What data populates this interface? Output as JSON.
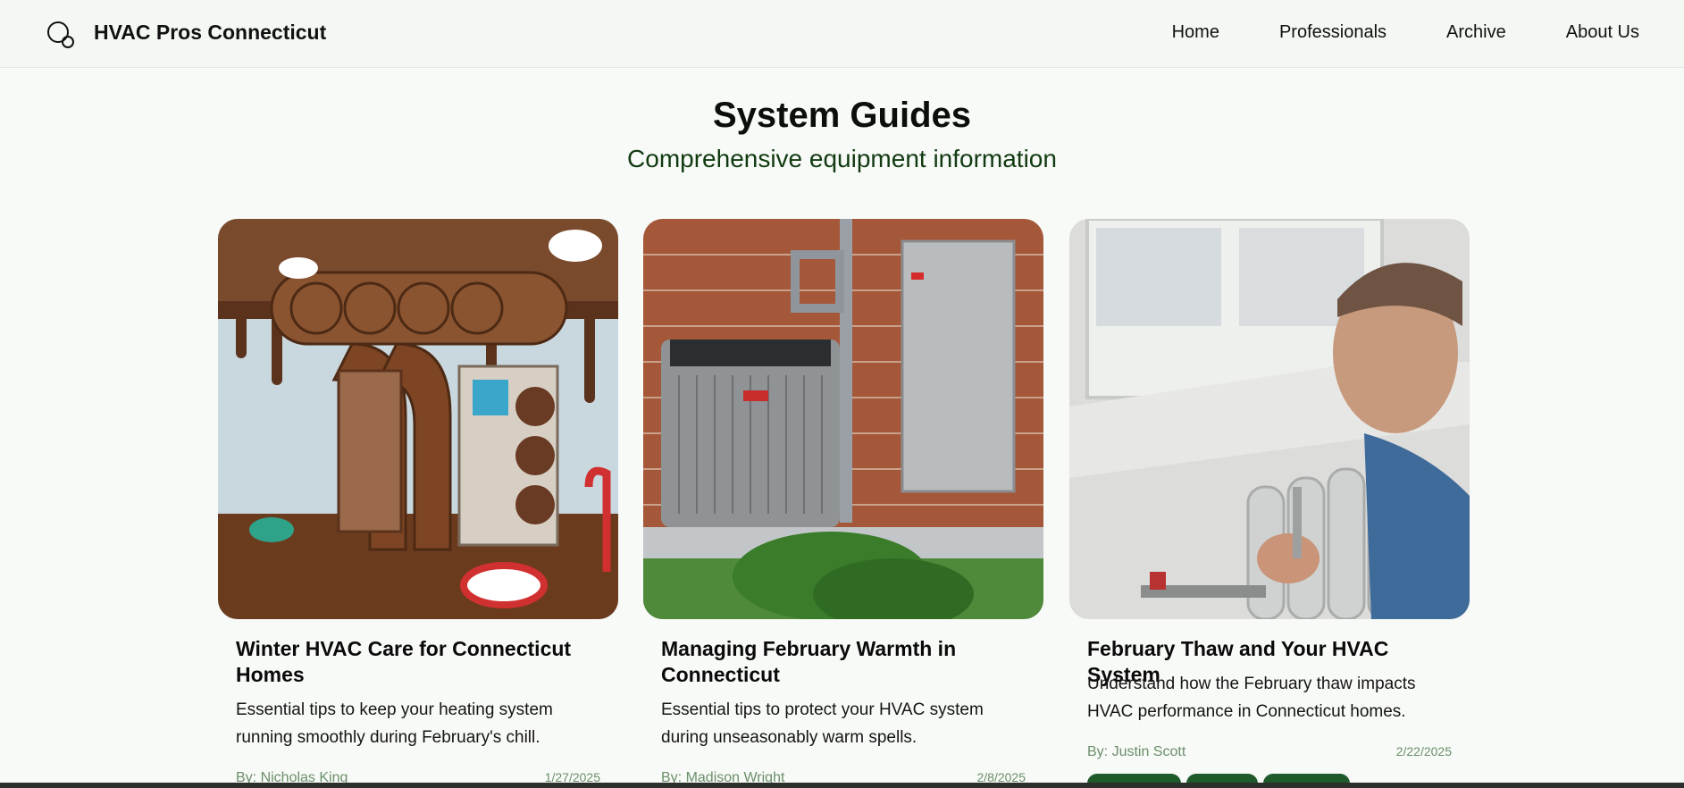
{
  "header": {
    "brand": "HVAC Pros Connecticut",
    "logo_icon": "magnifier-circles-icon",
    "nav": [
      "Home",
      "Professionals",
      "Archive",
      "About Us"
    ]
  },
  "hero": {
    "title": "System Guides",
    "subtitle": "Comprehensive equipment information"
  },
  "cards": [
    {
      "title": "Winter HVAC Care for Connecticut Homes",
      "excerpt": "Essential tips to keep your heating system running smoothly during February's chill.",
      "author": "By: Nicholas King",
      "date": "1/27/2025",
      "image": "chocolate-hvac-illustration"
    },
    {
      "title": "Managing February Warmth in Connecticut",
      "excerpt": "Essential tips to protect your HVAC system during unseasonably warm spells.",
      "author": "By: Madison Wright",
      "date": "2/8/2025",
      "image": "outdoor-ac-unit-photo"
    },
    {
      "title": "February Thaw and Your HVAC System",
      "excerpt": "Understand how the February thaw impacts HVAC performance in Connecticut homes.",
      "author": "By: Justin Scott",
      "date": "2/22/2025",
      "image": "radiator-technician-photo"
    }
  ],
  "colors": {
    "background": "#f7faf6",
    "accent": "#1f5a2a",
    "meta_text": "#6c8f6c"
  }
}
